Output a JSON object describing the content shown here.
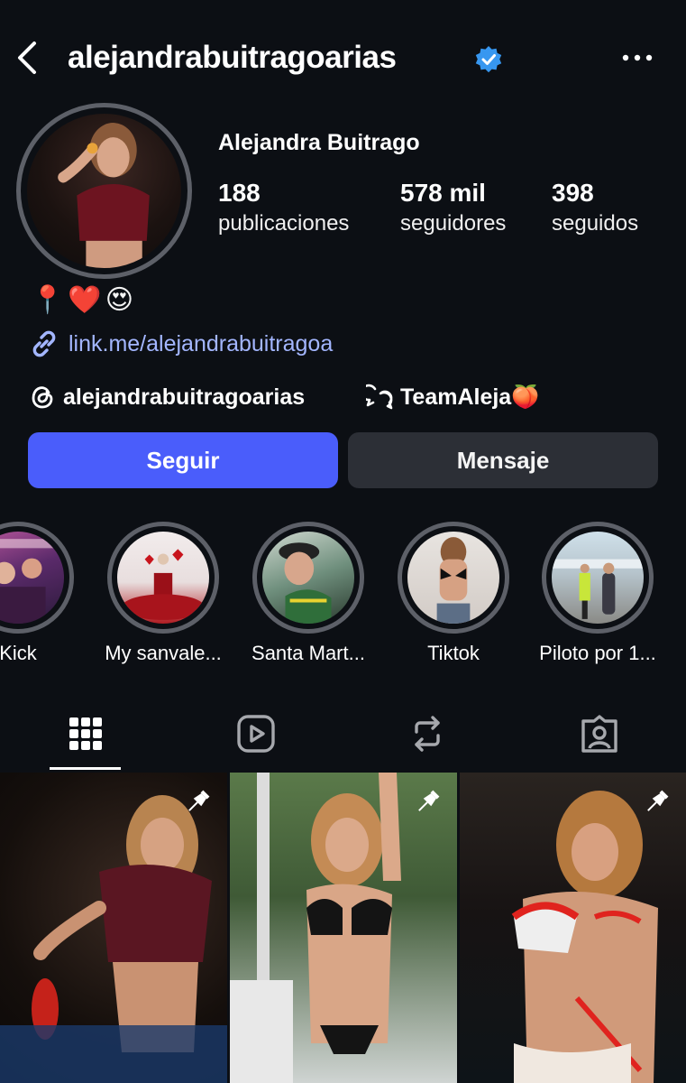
{
  "header": {
    "username": "alejandrabuitragoarias",
    "icons": {
      "back": "chevron-left-icon",
      "verified": "verified-badge-icon",
      "more": "more-dots-icon"
    }
  },
  "profile": {
    "display_name": "Alejandra Buitrago",
    "stats": [
      {
        "value": "188",
        "label": "publicaciones"
      },
      {
        "value": "578 mil",
        "label": "seguidores"
      },
      {
        "value": "398",
        "label": "seguidos"
      }
    ],
    "bio_emojis": "📍❤️😍",
    "link": "link.me/alejandrabuitragoa",
    "threads_handle": "alejandrabuitragoarias",
    "team": "TeamAleja🍑"
  },
  "actions": {
    "follow": "Seguir",
    "message": "Mensaje"
  },
  "highlights": [
    {
      "label": "Kick"
    },
    {
      "label": "My sanvale..."
    },
    {
      "label": "Santa Mart..."
    },
    {
      "label": "Tiktok"
    },
    {
      "label": "Piloto por 1..."
    }
  ],
  "tabs": [
    {
      "name": "grid-icon",
      "active": true
    },
    {
      "name": "reels-icon",
      "active": false
    },
    {
      "name": "reposts-icon",
      "active": false
    },
    {
      "name": "tagged-icon",
      "active": false
    }
  ],
  "colors": {
    "background": "#0c0f14",
    "follow_button": "#4a5dfb",
    "message_button": "#2c2f36",
    "link": "#a3b6ff",
    "verified": "#3797f0"
  }
}
